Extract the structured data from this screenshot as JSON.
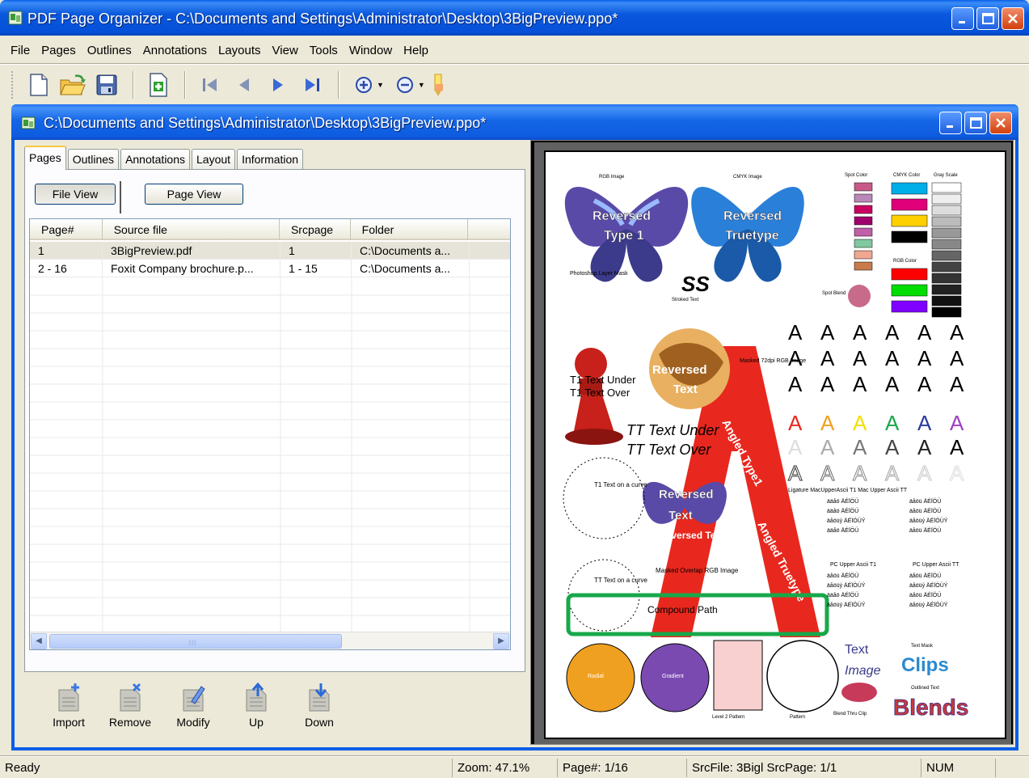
{
  "app": {
    "title": "PDF Page Organizer - C:\\Documents and Settings\\Administrator\\Desktop\\3BigPreview.ppo*"
  },
  "menu": [
    "File",
    "Pages",
    "Outlines",
    "Annotations",
    "Layouts",
    "View",
    "Tools",
    "Window",
    "Help"
  ],
  "toolbar": {
    "icons": [
      "new-file-icon",
      "open-folder-icon",
      "save-icon",
      "insert-page-icon",
      "first-page-icon",
      "prev-page-icon",
      "next-page-icon",
      "last-page-icon",
      "zoom-in-icon",
      "zoom-out-icon",
      "highlighter-icon"
    ]
  },
  "child": {
    "title": "C:\\Documents and Settings\\Administrator\\Desktop\\3BigPreview.ppo*"
  },
  "tabs": [
    "Pages",
    "Outlines",
    "Annotations",
    "Layout",
    "Information"
  ],
  "view_buttons": {
    "file_view": "File View",
    "page_view": "Page View"
  },
  "table": {
    "columns": [
      "Page#",
      "Source file",
      "Srcpage",
      "Folder"
    ],
    "rows": [
      [
        "1",
        "3BigPreview.pdf",
        "1",
        "C:\\Documents a..."
      ],
      [
        "2 - 16",
        "Foxit Company brochure.p...",
        "1 - 15",
        "C:\\Documents a..."
      ]
    ]
  },
  "actions": [
    "Import",
    "Remove",
    "Modify",
    "Up",
    "Down"
  ],
  "preview": {
    "labels": {
      "rgb_image": "RGB Image",
      "cmyk_image": "CMYK Image",
      "reversed_type1": "Reversed Type 1",
      "reversed_truetype": "Reversed Truetype",
      "photoshop_mask": "Photoshop Layer Mask",
      "stroked_text": "Stroked Text",
      "t1_text_under": "T1 Text Under",
      "t1_text_over": "T1 Text Over",
      "tt_text_under": "TT Text Under",
      "tt_text_over": "TT Text Over",
      "reversed_text": "Reversed Text",
      "angled_type1": "Angled Type1",
      "angled_truetype": "Angled Truetype",
      "compound_path": "Compound Path",
      "masked_overlap": "Masked Overlap RGB Image",
      "masked_72dpi": "Masked 72dpi RGB Image",
      "t1_text_curve": "T1 Text on a curve",
      "tt_text_curve": "TT Text on a curve",
      "radial": "Radial",
      "gradient": "Gradient",
      "level2_pattern": "Level 2 Pattern",
      "pattern": "Pattern",
      "text": "Text",
      "image": "Image",
      "clips": "Clips",
      "text_mask": "Text Mask",
      "outlined_text": "Outlined Text",
      "blends": "Blends",
      "blend_thru_clip": "Blend Thru Clip",
      "spot_blend": "Spot Blend",
      "spot_color": "Spot Color",
      "cmyk_color": "CMYK Color",
      "gray_scale": "Gray Scale",
      "rgb_color": "RGB Color"
    },
    "colors": {
      "red": "#e8281e",
      "green_frame": "#18a84a",
      "cyan": "#00aee8",
      "magenta": "#e0007a",
      "yellow": "#ffe400"
    }
  },
  "status": {
    "ready": "Ready",
    "zoom": "Zoom: 47.1%",
    "page": "Page#: 1/16",
    "src": "SrcFile: 3Bigl SrcPage: 1/1",
    "num": "NUM"
  }
}
